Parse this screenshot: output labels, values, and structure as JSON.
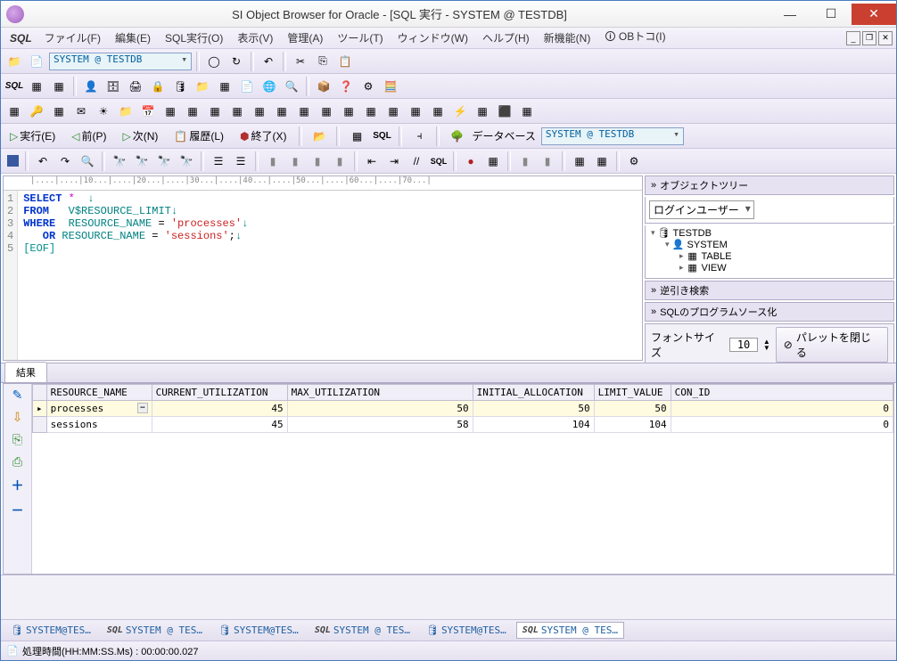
{
  "titlebar": {
    "title": "SI Object Browser for Oracle - [SQL 実行 - SYSTEM @ TESTDB]"
  },
  "menu": {
    "items": [
      "ファイル(F)",
      "編集(E)",
      "SQL実行(O)",
      "表示(V)",
      "管理(A)",
      "ツール(T)",
      "ウィンドウ(W)",
      "ヘルプ(H)",
      "新機能(N)"
    ],
    "obtoko": "OBトコ(I)"
  },
  "connection": {
    "combo": "SYSTEM @ TESTDB"
  },
  "runrow": {
    "exec": "実行(E)",
    "prev": "前(P)",
    "next": "次(N)",
    "history": "履歴(L)",
    "end": "終了(X)",
    "database_label": "データベース",
    "db_combo": "SYSTEM @ TESTDB"
  },
  "ruler": "|....|....|10...|....|20...|....|30...|....|40...|....|50...|....|60...|....|70...|",
  "sql": {
    "lines": [
      "1",
      "2",
      "3",
      "4",
      "5"
    ],
    "l1": {
      "kw": "SELECT",
      "star": " *",
      "para": "  ↓"
    },
    "l2": {
      "kw": "FROM",
      "sp": "   ",
      "id": "V$RESOURCE_LIMIT",
      "para": "↓"
    },
    "l3": {
      "kw": "WHERE",
      "sp": "  ",
      "id": "RESOURCE_NAME",
      "eq": " = ",
      "str": "'processes'",
      "para": "↓"
    },
    "l4": {
      "kw": "   OR",
      "sp": " ",
      "id": "RESOURCE_NAME",
      "eq": " = ",
      "str": "'sessions'",
      "semi": ";",
      "para": "↓"
    },
    "l5": {
      "eof": "[EOF]"
    }
  },
  "sidebar": {
    "obj_tree": "オブジェクトツリー",
    "login_user": "ログインユーザー",
    "tree": {
      "db": "TESTDB",
      "schema": "SYSTEM",
      "table": "TABLE",
      "view": "VIEW"
    },
    "reverse": "逆引き検索",
    "sqlprog": "SQLのプログラムソース化",
    "font_label": "フォントサイズ",
    "font_size": "10",
    "close_palette": "パレットを閉じる"
  },
  "result": {
    "tab": "結果",
    "columns": [
      "RESOURCE_NAME",
      "CURRENT_UTILIZATION",
      "MAX_UTILIZATION",
      "INITIAL_ALLOCATION",
      "LIMIT_VALUE",
      "CON_ID"
    ],
    "rows": [
      {
        "resource_name": "processes",
        "current_utilization": "45",
        "max_utilization": "50",
        "initial_allocation": "50",
        "limit_value": "50",
        "con_id": "0"
      },
      {
        "resource_name": "sessions",
        "current_utilization": "45",
        "max_utilization": "58",
        "initial_allocation": "104",
        "limit_value": "104",
        "con_id": "0"
      }
    ]
  },
  "wintabs": {
    "t0": "SYSTEM@TES…",
    "t1": "SYSTEM @ TES…",
    "t2": "SYSTEM@TES…",
    "t3": "SYSTEM @ TES…",
    "t4": "SYSTEM@TES…",
    "t5": "SYSTEM @ TES…"
  },
  "status": {
    "text": "処理時間(HH:MM:SS.Ms) : 00:00:00.027"
  }
}
